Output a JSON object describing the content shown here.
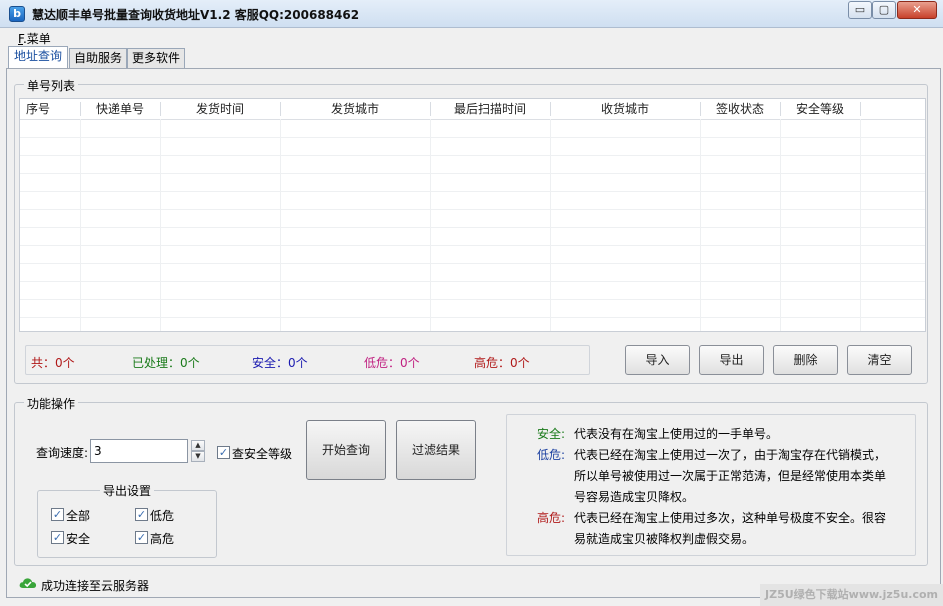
{
  "window": {
    "title": "慧达顺丰单号批量查询收货地址V1.2 客服QQ:200688462",
    "icon_letter": "b",
    "minimize_glyph": "▭",
    "maximize_glyph": "▢",
    "close_glyph": "✕"
  },
  "menu": {
    "prefix": "F",
    "label": ".菜单"
  },
  "tabs": [
    {
      "label": "地址查询",
      "active": true
    },
    {
      "label": "自助服务",
      "active": false
    },
    {
      "label": "更多软件",
      "active": false
    }
  ],
  "list_group": {
    "title": "单号列表",
    "columns": [
      "序号",
      "快递单号",
      "发货时间",
      "发货城市",
      "最后扫描时间",
      "收货城市",
      "签收状态",
      "安全等级"
    ]
  },
  "stats": {
    "total": "共：0个",
    "processed": "已处理：0个",
    "safe": "安全：0个",
    "low": "低危：0个",
    "high": "高危：0个",
    "colors": {
      "total": "#b01818",
      "processed": "#1a7a1a",
      "safe": "#1a1ab0",
      "low": "#c02080",
      "high": "#b01818"
    }
  },
  "list_buttons": {
    "import": "导入",
    "export": "导出",
    "delete": "删除",
    "clear": "清空"
  },
  "ops_group": {
    "title": "功能操作",
    "speed_label": "查询速度:",
    "speed_value": "3",
    "check_security_label": "查安全等级",
    "start_button": "开始查询",
    "filter_button": "过滤结果",
    "export_settings": {
      "title": "导出设置",
      "all": "全部",
      "low": "低危",
      "safe": "安全",
      "high": "高危"
    }
  },
  "legend": {
    "safe_key": "安全:",
    "safe_text": "代表没有在淘宝上使用过的一手单号。",
    "low_key": "低危:",
    "low_text_1": "代表已经在淘宝上使用过一次了，由于淘宝存在代销模式，",
    "low_text_2": "所以单号被使用过一次属于正常范涛，但是经常使用本类单",
    "low_text_3": "号容易造成宝贝降权。",
    "high_key": "高危:",
    "high_text_1": "代表已经在淘宝上使用过多次，这种单号极度不安全。很容",
    "high_text_2": "易就造成宝贝被降权判虚假交易。",
    "colors": {
      "safe": "#1a7a1a",
      "low": "#1a3fa0",
      "high": "#b01818"
    }
  },
  "status": {
    "text": "成功连接至云服务器",
    "icon": "cloud-check-icon",
    "watermark": "JZ5U绿色下载站www.jz5u.com"
  }
}
